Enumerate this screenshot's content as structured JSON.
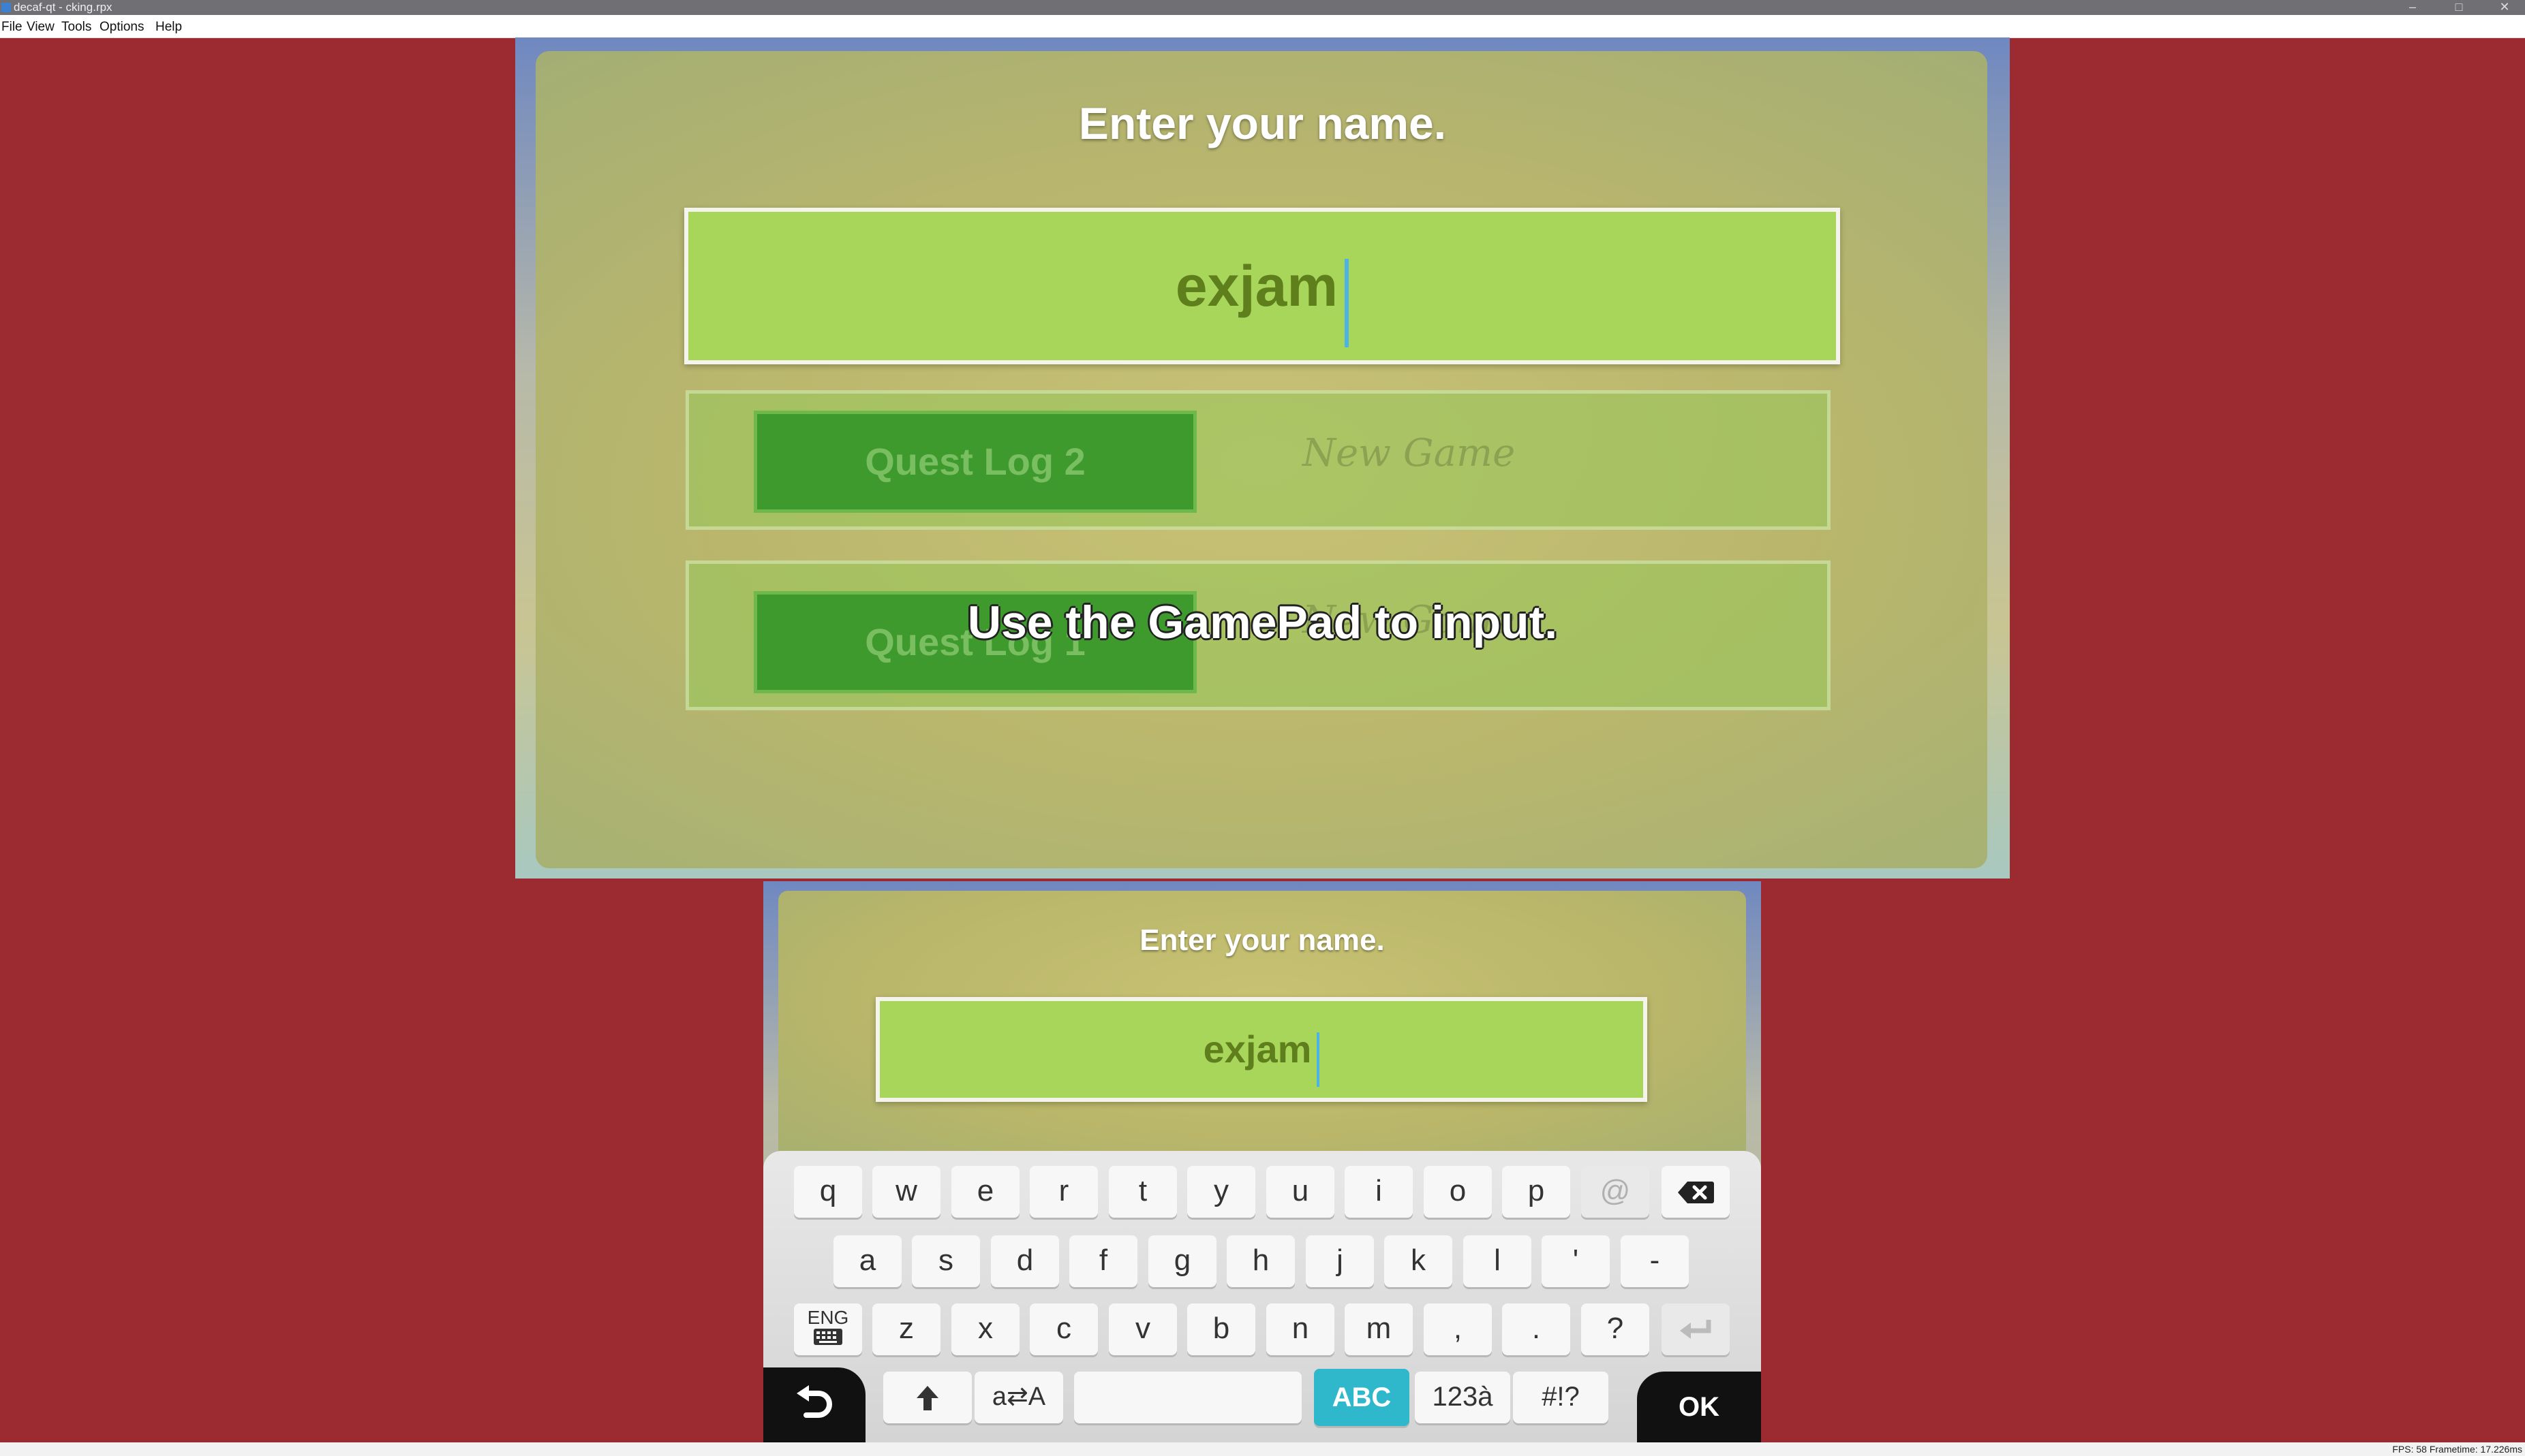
{
  "window": {
    "title": "decaf-qt - cking.rpx",
    "controls": {
      "minimize": "–",
      "maximize": "□",
      "close": "✕"
    }
  },
  "menu": [
    "File",
    "View",
    "Tools",
    "Options",
    "Help"
  ],
  "tv_screen": {
    "heading": "Enter your name.",
    "name_value": "exjam",
    "quest_rows": [
      {
        "button": "Quest Log 2",
        "label": "New Game"
      },
      {
        "button": "Quest Log 1",
        "label": "New Game"
      }
    ],
    "hint": "Use the GamePad to input."
  },
  "gamepad_screen": {
    "heading": "Enter your name.",
    "name_value": "exjam"
  },
  "keyboard": {
    "row1": [
      "q",
      "w",
      "e",
      "r",
      "t",
      "y",
      "u",
      "i",
      "o",
      "p",
      "@"
    ],
    "row2": [
      "a",
      "s",
      "d",
      "f",
      "g",
      "h",
      "j",
      "k",
      "l",
      "'",
      "-"
    ],
    "row3": [
      "z",
      "x",
      "c",
      "v",
      "b",
      "n",
      "m",
      ",",
      ".",
      "?"
    ],
    "lang_key": "ENG",
    "case_key": "a⇄A",
    "space_key": "",
    "mode_keys": [
      "ABC",
      "123à",
      "#!?"
    ],
    "ok_label": "OK",
    "icons": {
      "backspace": "backspace-icon",
      "enter": "enter-icon",
      "shift": "shift-icon",
      "back": "back-icon",
      "keyboard": "keyboard-icon"
    }
  },
  "status": {
    "fps_text": "FPS: 58 Frametime: 17.226ms"
  },
  "colors": {
    "background": "#9b2b30",
    "name_box": "#a8d65b",
    "active_mode": "#2fb8cc"
  }
}
